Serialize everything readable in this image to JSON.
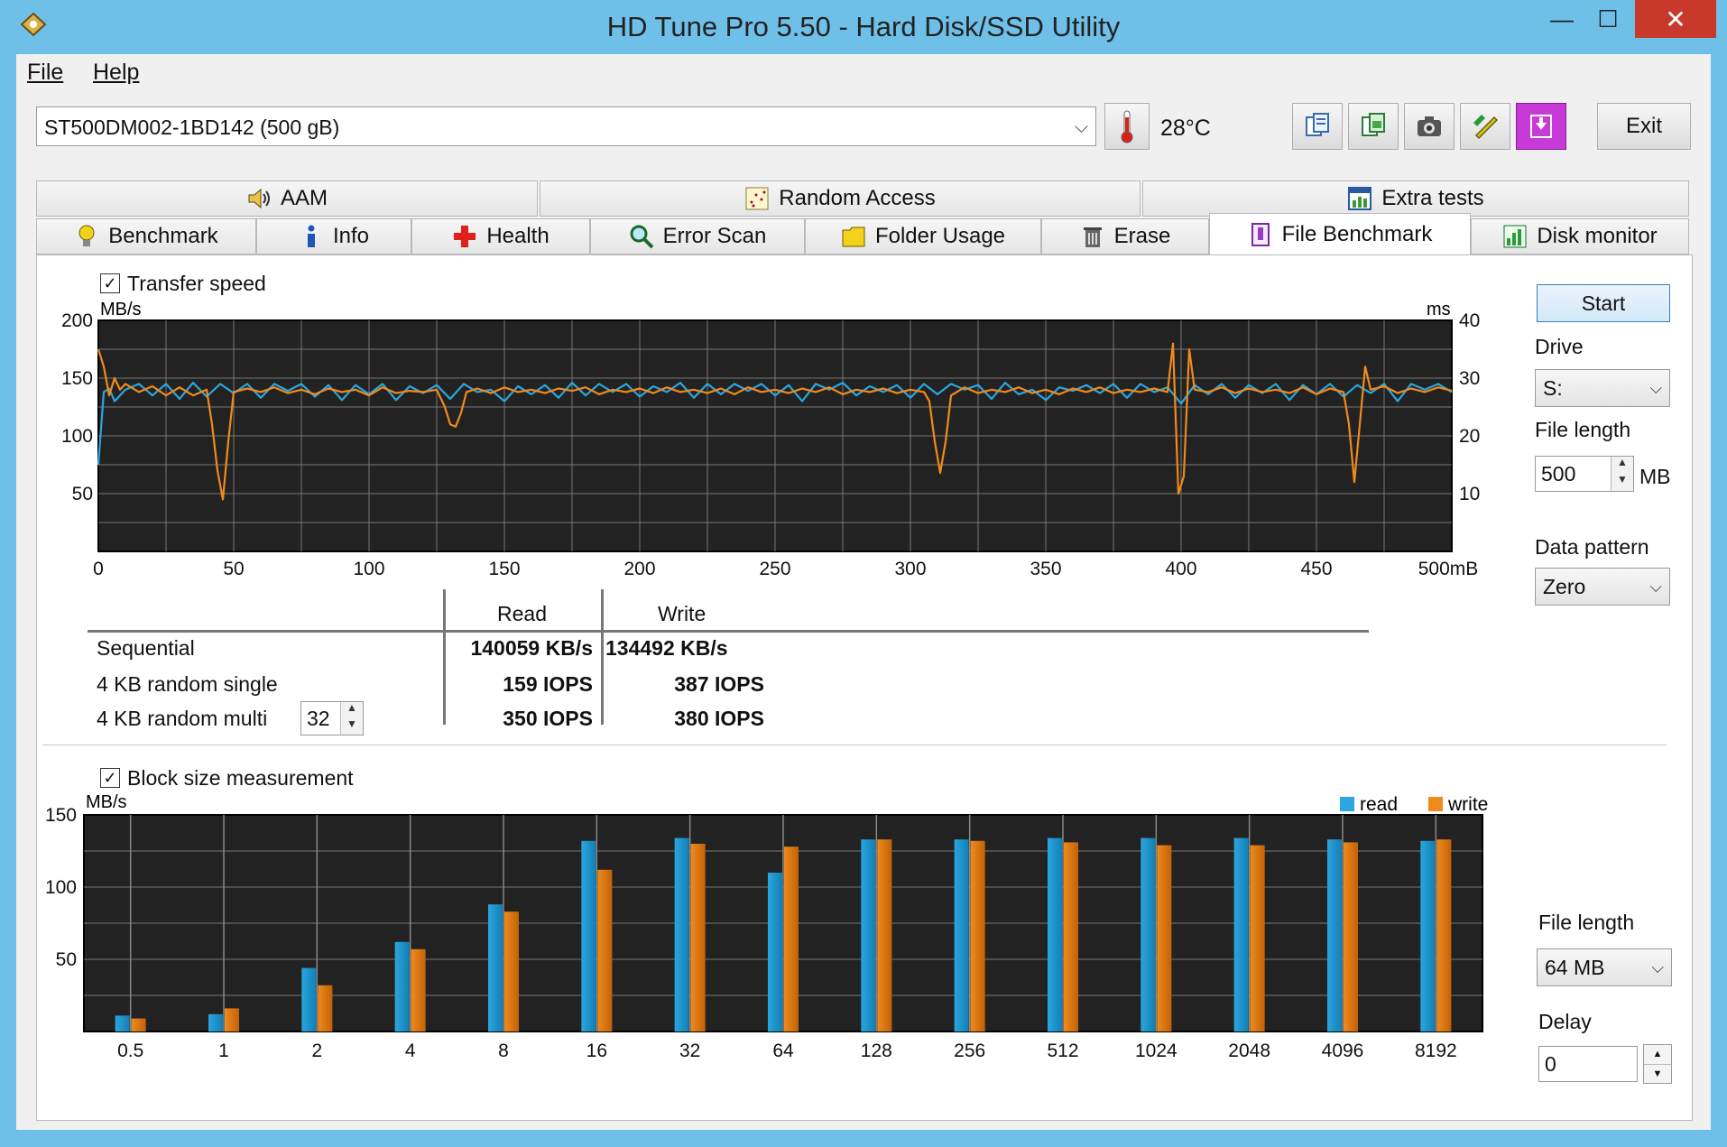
{
  "window": {
    "title": "HD Tune Pro 5.50 - Hard Disk/SSD Utility",
    "controls": {
      "minimize": "—",
      "maximize": "☐",
      "close": "✕"
    }
  },
  "menu": {
    "file": "File",
    "help": "Help"
  },
  "toolbar": {
    "drive": "ST500DM002-1BD142 (500 gB)",
    "temperature": "28°C",
    "exit_label": "Exit",
    "icons": [
      "copy-info-icon",
      "copy-screenshot-icon",
      "camera-icon",
      "options-icon",
      "save-icon"
    ]
  },
  "tabs": {
    "top": [
      {
        "label": "AAM",
        "icon": "speaker-icon"
      },
      {
        "label": "Random Access",
        "icon": "random-access-icon"
      },
      {
        "label": "Extra tests",
        "icon": "extra-tests-icon"
      }
    ],
    "bottom": [
      {
        "label": "Benchmark",
        "icon": "bulb-icon"
      },
      {
        "label": "Info",
        "icon": "info-icon"
      },
      {
        "label": "Health",
        "icon": "health-cross-icon"
      },
      {
        "label": "Error Scan",
        "icon": "magnifier-icon"
      },
      {
        "label": "Folder Usage",
        "icon": "folder-icon"
      },
      {
        "label": "Erase",
        "icon": "trash-icon"
      },
      {
        "label": "File Benchmark",
        "icon": "file-benchmark-icon"
      },
      {
        "label": "Disk monitor",
        "icon": "disk-monitor-icon"
      }
    ],
    "active": "File Benchmark"
  },
  "transfer": {
    "checkbox_label": "Transfer speed",
    "checked": true,
    "start_label": "Start",
    "drive_label": "Drive",
    "drive_value": "S:",
    "file_length_label": "File length",
    "file_length_value": "500",
    "file_length_unit": "MB",
    "data_pattern_label": "Data pattern",
    "data_pattern_value": "Zero"
  },
  "results": {
    "col_read": "Read",
    "col_write": "Write",
    "rows": [
      {
        "label": "Sequential",
        "read": "140059 KB/s",
        "write": "134492 KB/s"
      },
      {
        "label": "4 KB random single",
        "read": "159 IOPS",
        "write": "387 IOPS"
      },
      {
        "label": "4 KB random multi",
        "read": "350 IOPS",
        "write": "380 IOPS"
      }
    ],
    "queue_depth": "32"
  },
  "block": {
    "checkbox_label": "Block size measurement",
    "checked": true,
    "file_length_label": "File length",
    "file_length_value": "64 MB",
    "delay_label": "Delay",
    "delay_value": "0"
  },
  "chart_data": [
    {
      "type": "line",
      "ylabel": "MB/s",
      "y2label": "ms",
      "xunit": "500mB",
      "xlim": [
        0,
        500
      ],
      "ylim": [
        0,
        200
      ],
      "y2lim": [
        0,
        40
      ],
      "xticks": [
        "0",
        "50",
        "100",
        "150",
        "200",
        "250",
        "300",
        "350",
        "400",
        "450"
      ],
      "yticks": [
        "50",
        "100",
        "150",
        "200"
      ],
      "y2ticks": [
        "10",
        "20",
        "30",
        "40"
      ],
      "grid": true,
      "colors": {
        "read": "#2aa6e0",
        "write": "#f08a1c"
      },
      "series": [
        {
          "key": "read",
          "x": [
            0,
            2,
            4,
            6,
            10,
            15,
            20,
            25,
            30,
            35,
            40,
            45,
            50,
            55,
            60,
            65,
            70,
            75,
            80,
            85,
            90,
            95,
            100,
            105,
            110,
            115,
            120,
            125,
            130,
            135,
            140,
            145,
            150,
            155,
            160,
            165,
            170,
            175,
            180,
            185,
            190,
            195,
            200,
            205,
            210,
            215,
            220,
            225,
            230,
            235,
            240,
            245,
            250,
            255,
            260,
            265,
            270,
            275,
            280,
            285,
            290,
            295,
            300,
            305,
            310,
            315,
            320,
            325,
            330,
            335,
            340,
            345,
            350,
            355,
            360,
            365,
            370,
            375,
            380,
            385,
            390,
            395,
            400,
            405,
            410,
            415,
            420,
            425,
            430,
            435,
            440,
            445,
            450,
            455,
            460,
            465,
            470,
            475,
            480,
            485,
            490,
            495,
            500
          ],
          "y": [
            75,
            138,
            141,
            130,
            140,
            145,
            135,
            145,
            132,
            146,
            134,
            145,
            137,
            145,
            133,
            145,
            139,
            145,
            134,
            144,
            131,
            144,
            136,
            145,
            131,
            143,
            137,
            144,
            132,
            145,
            138,
            140,
            130,
            143,
            136,
            144,
            133,
            146,
            135,
            145,
            138,
            145,
            134,
            143,
            138,
            146,
            133,
            145,
            136,
            145,
            139,
            145,
            135,
            144,
            130,
            145,
            140,
            146,
            135,
            143,
            138,
            144,
            133,
            145,
            136,
            145,
            140,
            144,
            132,
            146,
            136,
            140,
            131,
            142,
            139,
            144,
            137,
            145,
            133,
            145,
            138,
            142,
            128,
            144,
            136,
            145,
            133,
            144,
            137,
            145,
            131,
            144,
            136,
            145,
            134,
            144,
            137,
            145,
            130,
            145,
            140,
            145,
            138
          ]
        },
        {
          "key": "write",
          "x": [
            0,
            2,
            4,
            6,
            8,
            10,
            15,
            20,
            25,
            30,
            35,
            40,
            42,
            44,
            46,
            48,
            50,
            55,
            60,
            65,
            70,
            75,
            80,
            85,
            90,
            95,
            100,
            105,
            110,
            115,
            120,
            125,
            128,
            130,
            132,
            134,
            136,
            140,
            145,
            150,
            155,
            160,
            165,
            170,
            175,
            180,
            185,
            190,
            195,
            200,
            205,
            210,
            215,
            220,
            225,
            230,
            235,
            240,
            245,
            250,
            255,
            260,
            265,
            270,
            275,
            280,
            285,
            290,
            295,
            300,
            305,
            307,
            309,
            311,
            313,
            315,
            320,
            325,
            330,
            335,
            340,
            345,
            350,
            355,
            360,
            365,
            370,
            375,
            380,
            385,
            390,
            395,
            397,
            399,
            401,
            403,
            405,
            410,
            415,
            420,
            425,
            430,
            435,
            440,
            445,
            450,
            455,
            460,
            462,
            464,
            466,
            468,
            470,
            475,
            480,
            485,
            490,
            495,
            500
          ],
          "y": [
            175,
            160,
            135,
            150,
            140,
            145,
            138,
            143,
            135,
            142,
            135,
            140,
            110,
            70,
            45,
            95,
            138,
            141,
            138,
            142,
            137,
            140,
            136,
            141,
            138,
            140,
            135,
            142,
            137,
            139,
            138,
            140,
            125,
            110,
            108,
            120,
            138,
            141,
            137,
            142,
            138,
            140,
            137,
            141,
            139,
            142,
            136,
            140,
            138,
            141,
            137,
            142,
            138,
            140,
            137,
            141,
            136,
            142,
            138,
            140,
            137,
            141,
            138,
            142,
            136,
            140,
            138,
            141,
            137,
            140,
            138,
            130,
            95,
            68,
            95,
            135,
            142,
            137,
            140,
            138,
            142,
            137,
            140,
            136,
            141,
            138,
            142,
            137,
            140,
            138,
            141,
            138,
            180,
            50,
            65,
            175,
            140,
            138,
            142,
            137,
            141,
            138,
            140,
            137,
            142,
            136,
            141,
            138,
            110,
            60,
            110,
            160,
            140,
            143,
            137,
            141,
            138,
            142,
            139
          ]
        }
      ]
    },
    {
      "type": "bar",
      "ylabel": "MB/s",
      "ylim": [
        0,
        150
      ],
      "yticks": [
        "50",
        "100",
        "150"
      ],
      "grid": true,
      "legend": [
        "read",
        "write"
      ],
      "legend_position": "top-right",
      "categories": [
        "0.5",
        "1",
        "2",
        "4",
        "8",
        "16",
        "32",
        "64",
        "128",
        "256",
        "512",
        "1024",
        "2048",
        "4096",
        "8192"
      ],
      "series": [
        {
          "name": "read",
          "color": "#2aa6e0",
          "values": [
            11,
            12,
            44,
            62,
            88,
            132,
            134,
            110,
            133,
            133,
            134,
            134,
            134,
            133,
            132
          ]
        },
        {
          "name": "write",
          "color": "#f08a1c",
          "values": [
            9,
            16,
            32,
            57,
            83,
            112,
            130,
            128,
            133,
            132,
            131,
            129,
            129,
            131,
            133
          ]
        }
      ]
    }
  ]
}
